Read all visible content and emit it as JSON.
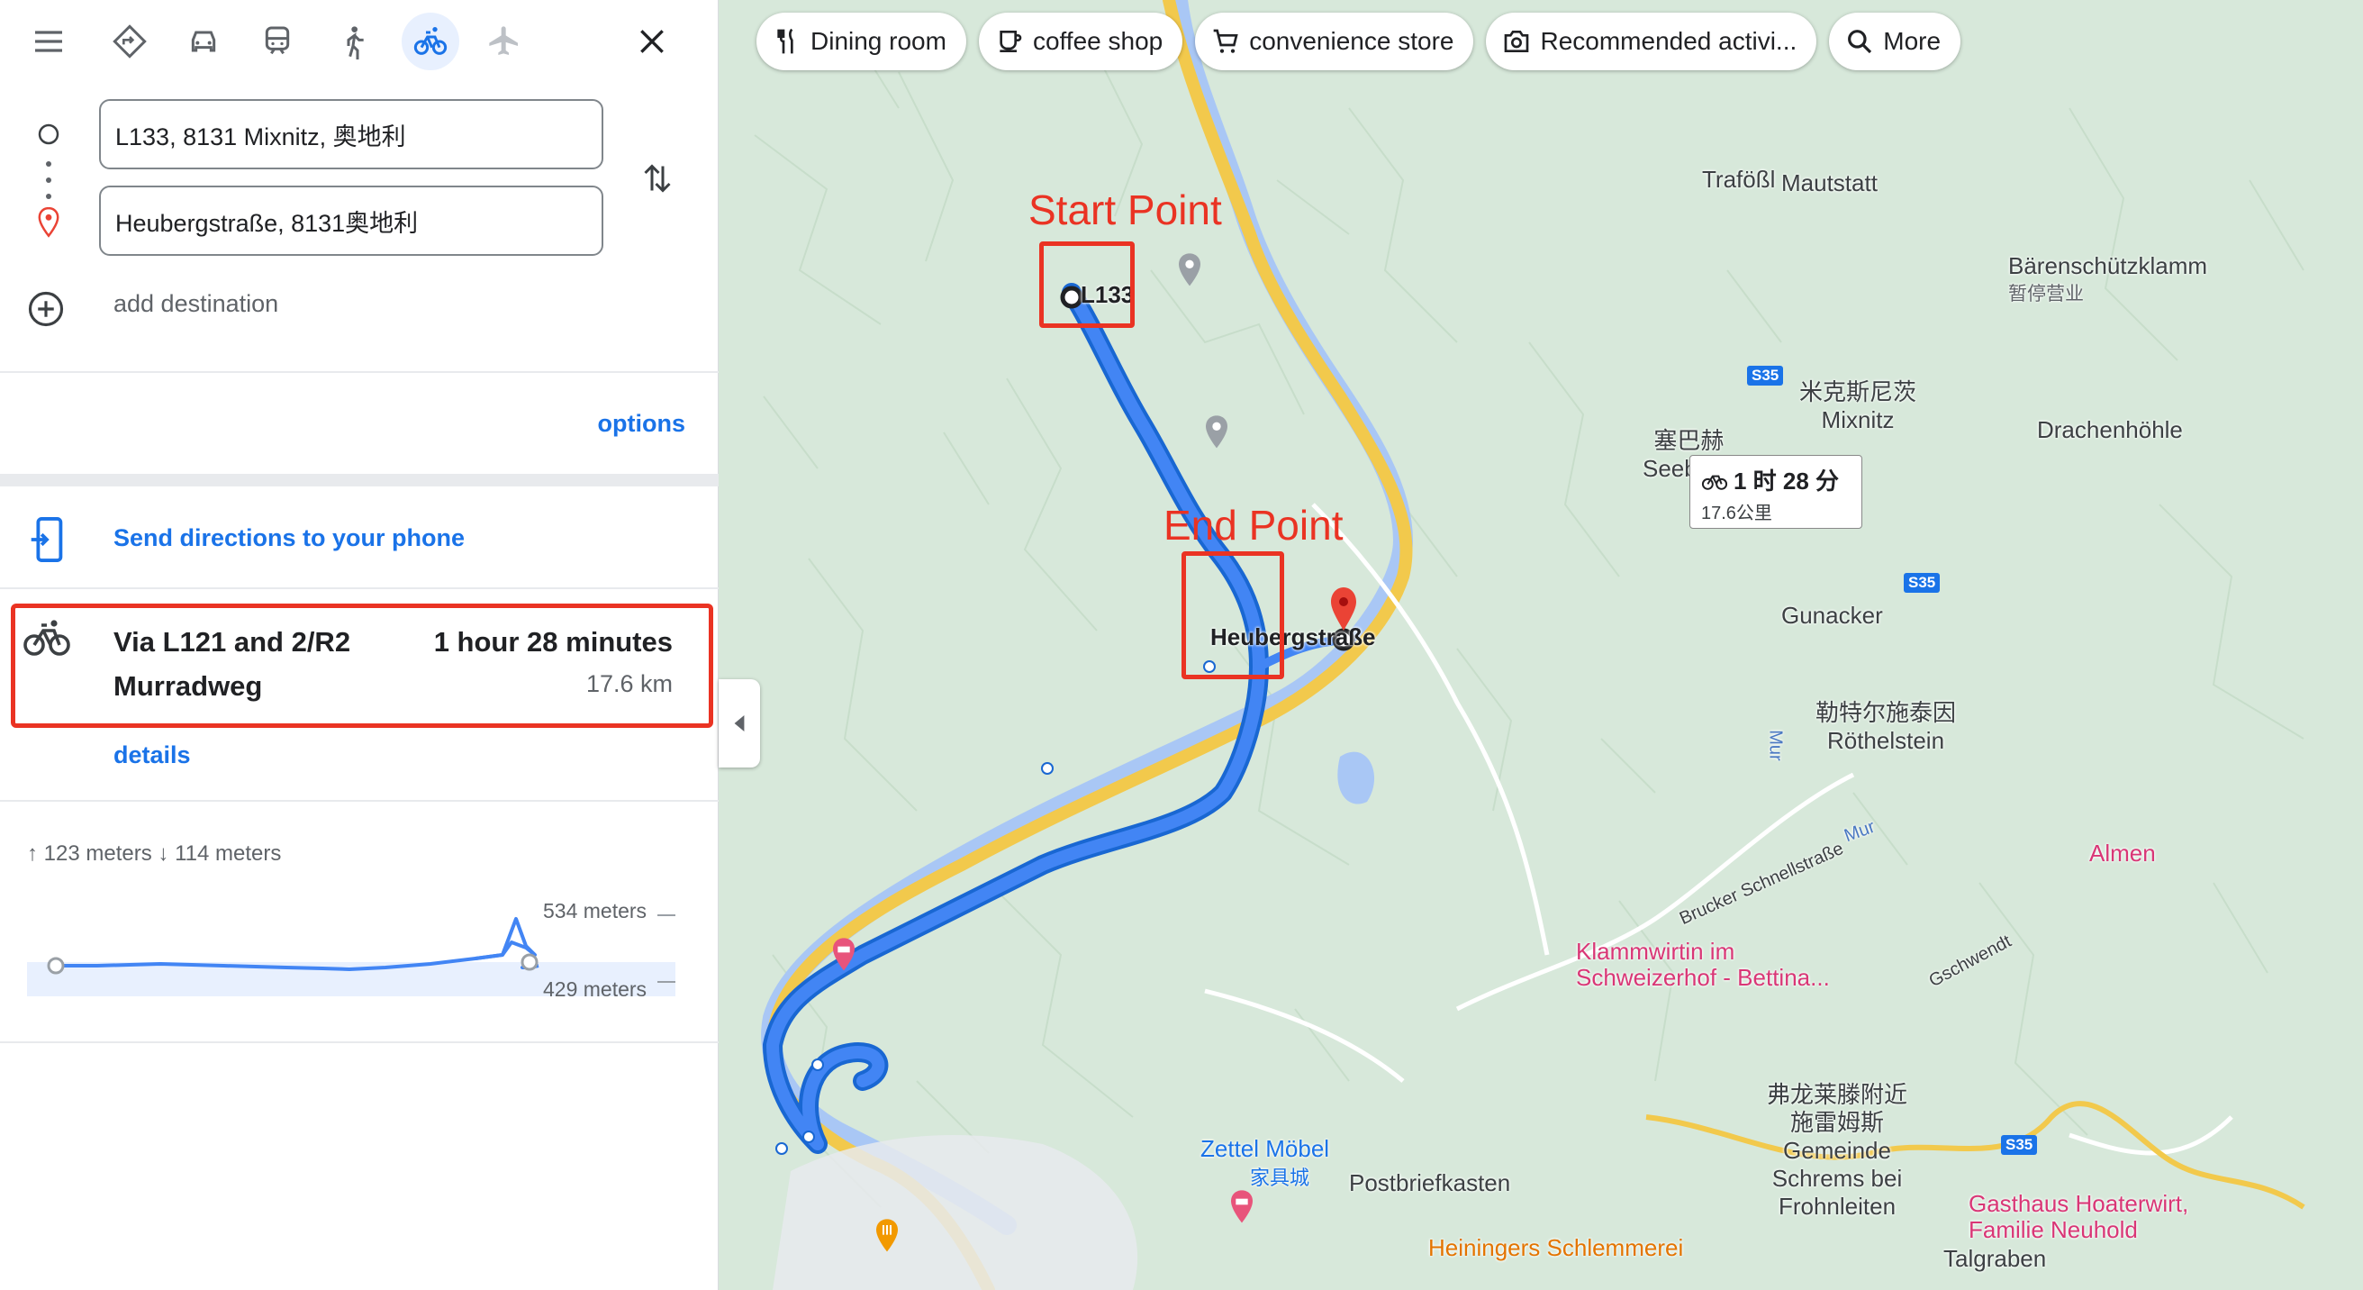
{
  "travel_modes": [
    {
      "name": "best-route",
      "label": "Best travel modes"
    },
    {
      "name": "driving",
      "label": "Driving"
    },
    {
      "name": "transit",
      "label": "Transit"
    },
    {
      "name": "walking",
      "label": "Walking"
    },
    {
      "name": "cycling",
      "label": "Cycling",
      "active": true
    },
    {
      "name": "flights",
      "label": "Flights"
    }
  ],
  "directions": {
    "origin": "L133, 8131 Mixnitz, 奥地利",
    "destination": "Heubergstraße, 8131奥地利",
    "add_destination": "add destination",
    "options": "options",
    "send_to_phone": "Send directions to your phone"
  },
  "route": {
    "name_line1": "Via L121 and 2/R2",
    "name_line2": "Murradweg",
    "time": "1 hour 28 minutes",
    "distance": "17.6 km",
    "details": "details"
  },
  "elevation": {
    "summary": "123 meters 114 meters",
    "ascent": "123 meters",
    "descent": "114 meters",
    "max": "534 meters",
    "min": "429 meters"
  },
  "chips": [
    {
      "label": "Dining room",
      "icon": "fork-knife-icon"
    },
    {
      "label": "coffee shop",
      "icon": "coffee-icon"
    },
    {
      "label": "convenience store",
      "icon": "cart-icon"
    },
    {
      "label": "Recommended activi...",
      "icon": "camera-icon"
    },
    {
      "label": "More",
      "icon": "search-icon"
    }
  ],
  "map": {
    "tooltip_time": "1 时 28 分",
    "tooltip_distance": "17.6公里",
    "start_annotation": "Start Point",
    "end_annotation": "End Point",
    "start_label": "L133",
    "end_label": "Heubergstraße",
    "places": {
      "trafoss": "Trafößl",
      "mautstatt": "Mautstatt",
      "baerenschuetzklamm": "Bärenschützklamm",
      "baerenschuetzklamm_status": "暂停营业",
      "mixnitz_cn": "米克斯尼茨",
      "mixnitz": "Mixnitz",
      "seebach_cn": "塞巴赫",
      "seebach": "Seebach",
      "drachenhoehle": "Drachenhöhle",
      "gunacker": "Gunacker",
      "roethelstein_cn": "勒特尔施泰因",
      "roethelstein": "Röthelstein",
      "klammwirtin1": "Klammwirtin im",
      "klammwirtin2": "Schweizerhof - Bettina...",
      "zettel": "Zettel Möbel",
      "zettel_cn": "家具城",
      "postbrief": "Postbriefkasten",
      "frohnleiten_cn1": "弗龙莱滕附近",
      "frohnleiten_cn2": "施雷姆斯",
      "gemeinde1": "Gemeinde",
      "gemeinde2": "Schrems bei",
      "gemeinde3": "Frohnleiten",
      "heiningers": "Heiningers Schlemmerei",
      "gasthaus1": "Gasthaus Hoaterwirt,",
      "gasthaus2": "Familie Neuhold",
      "talgraben": "Talgraben",
      "almen": "Almen",
      "mur": "Mur",
      "brucker": "Brucker Schnellstraße",
      "gschwendt": "Gschwendt",
      "road_s35": "S35"
    }
  },
  "colors": {
    "accent": "#1a73e8",
    "annotation": "#ea3323",
    "route": "#4285f4",
    "map_bg": "#d7e8da"
  }
}
